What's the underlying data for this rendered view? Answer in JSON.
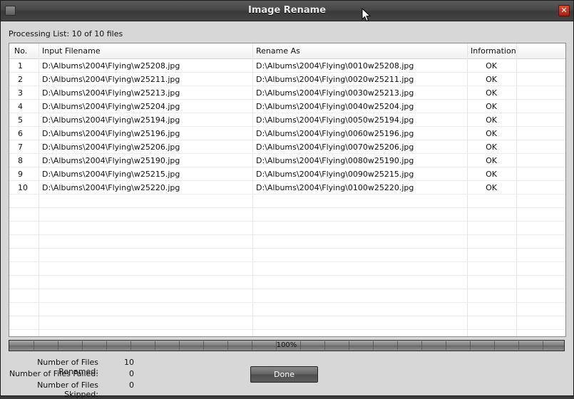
{
  "window": {
    "title": "Image Rename"
  },
  "processing_label": "Processing List: 10 of 10 files",
  "table": {
    "columns": [
      "No.",
      "Input Filename",
      "Rename As",
      "Information"
    ],
    "rows": [
      {
        "no": "1",
        "input": "D:\\Albums\\2004\\Flying\\w25208.jpg",
        "rename": "D:\\Albums\\2004\\Flying\\0010w25208.jpg",
        "info": "OK"
      },
      {
        "no": "2",
        "input": "D:\\Albums\\2004\\Flying\\w25211.jpg",
        "rename": "D:\\Albums\\2004\\Flying\\0020w25211.jpg",
        "info": "OK"
      },
      {
        "no": "3",
        "input": "D:\\Albums\\2004\\Flying\\w25213.jpg",
        "rename": "D:\\Albums\\2004\\Flying\\0030w25213.jpg",
        "info": "OK"
      },
      {
        "no": "4",
        "input": "D:\\Albums\\2004\\Flying\\w25204.jpg",
        "rename": "D:\\Albums\\2004\\Flying\\0040w25204.jpg",
        "info": "OK"
      },
      {
        "no": "5",
        "input": "D:\\Albums\\2004\\Flying\\w25194.jpg",
        "rename": "D:\\Albums\\2004\\Flying\\0050w25194.jpg",
        "info": "OK"
      },
      {
        "no": "6",
        "input": "D:\\Albums\\2004\\Flying\\w25196.jpg",
        "rename": "D:\\Albums\\2004\\Flying\\0060w25196.jpg",
        "info": "OK"
      },
      {
        "no": "7",
        "input": "D:\\Albums\\2004\\Flying\\w25206.jpg",
        "rename": "D:\\Albums\\2004\\Flying\\0070w25206.jpg",
        "info": "OK"
      },
      {
        "no": "8",
        "input": "D:\\Albums\\2004\\Flying\\w25190.jpg",
        "rename": "D:\\Albums\\2004\\Flying\\0080w25190.jpg",
        "info": "OK"
      },
      {
        "no": "9",
        "input": "D:\\Albums\\2004\\Flying\\w25215.jpg",
        "rename": "D:\\Albums\\2004\\Flying\\0090w25215.jpg",
        "info": "OK"
      },
      {
        "no": "10",
        "input": "D:\\Albums\\2004\\Flying\\w25220.jpg",
        "rename": "D:\\Albums\\2004\\Flying\\0100w25220.jpg",
        "info": "OK"
      }
    ]
  },
  "progress": {
    "percent": 100,
    "label": "100%"
  },
  "stats": [
    {
      "label": "Number of Files Renamed:",
      "value": "10"
    },
    {
      "label": "Number of Files Failed:",
      "value": "0"
    },
    {
      "label": "Number of Files Skipped:",
      "value": "0"
    }
  ],
  "buttons": {
    "done_label": "Done"
  },
  "icons": {
    "system_menu": "window-menu-icon",
    "close": "close-icon",
    "cursor": "mouse-cursor-icon"
  },
  "colors": {
    "title_bar": "#474747",
    "dialog_bg": "#d7d7d7",
    "close_button": "#c8321c"
  }
}
